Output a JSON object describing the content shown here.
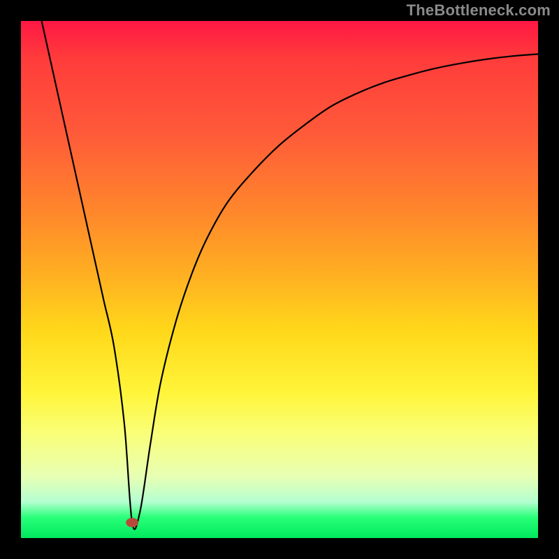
{
  "watermark": "TheBottleneck.com",
  "colors": {
    "frame": "#000000",
    "gradient_top": "#ff1744",
    "gradient_bottom": "#00e95e",
    "curve": "#000000",
    "marker": "#b84a3a"
  },
  "chart_data": {
    "type": "line",
    "title": "",
    "xlabel": "",
    "ylabel": "",
    "xlim": [
      0,
      100
    ],
    "ylim": [
      0,
      100
    ],
    "grid": false,
    "series": [
      {
        "name": "bottleneck-curve",
        "x": [
          4,
          6,
          8,
          10,
          12,
          14,
          16,
          18,
          20,
          21.5,
          23,
          25,
          27,
          30,
          33,
          36,
          40,
          45,
          50,
          55,
          60,
          65,
          70,
          75,
          80,
          85,
          90,
          95,
          100
        ],
        "y": [
          100,
          91,
          82,
          73,
          64,
          55,
          46,
          37,
          22,
          3,
          5,
          18,
          30,
          42,
          51,
          58,
          65,
          71,
          76,
          80,
          83.5,
          86,
          88,
          89.5,
          90.8,
          91.8,
          92.6,
          93.2,
          93.6
        ]
      }
    ],
    "marker": {
      "x": 21.5,
      "y": 3,
      "rx": 1.2,
      "ry": 0.9
    }
  }
}
